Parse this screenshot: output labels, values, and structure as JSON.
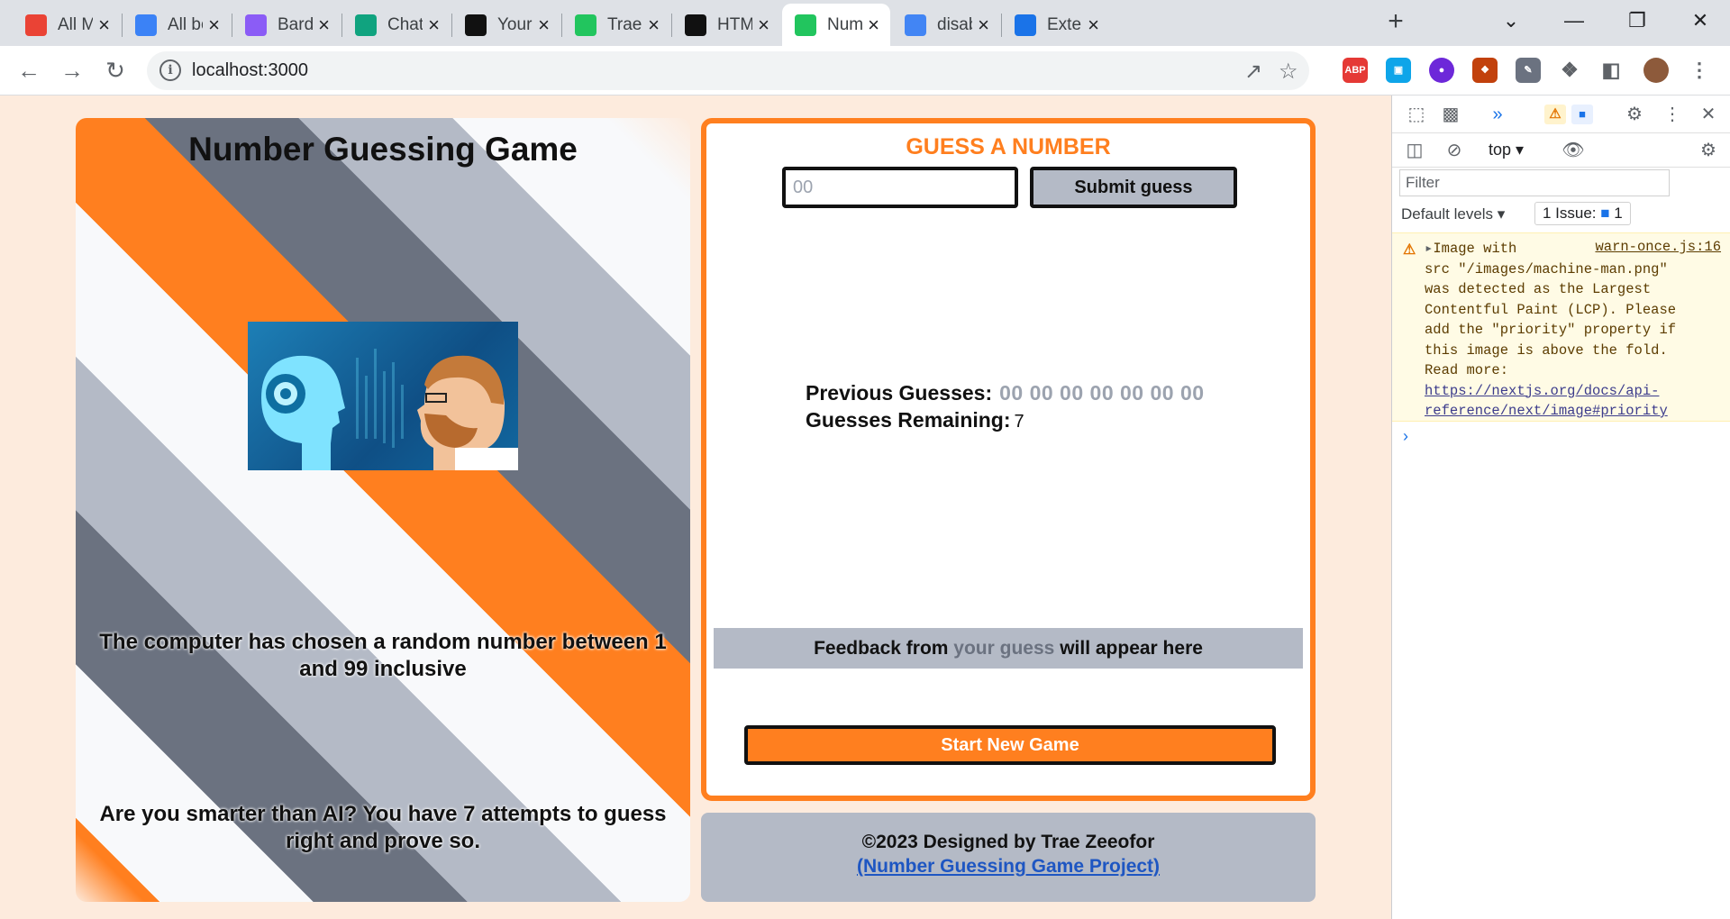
{
  "browser": {
    "tabs": [
      {
        "label": "All Mai",
        "icon": "gmail-icon",
        "color": "#ea4335"
      },
      {
        "label": "All boo",
        "icon": "cloud-icon",
        "color": "#3b82f6"
      },
      {
        "label": "Bard",
        "icon": "bard-icon",
        "color": "#8b5cf6"
      },
      {
        "label": "ChatGI",
        "icon": "chatgpt-icon",
        "color": "#10a37f"
      },
      {
        "label": "Your lis",
        "icon": "github-icon",
        "color": "#111111"
      },
      {
        "label": "Trae's",
        "icon": "pixel-icon",
        "color": "#22c55e"
      },
      {
        "label": "HTML",
        "icon": "notion-icon",
        "color": "#111111"
      },
      {
        "label": "Numbe",
        "icon": "pixel-icon",
        "color": "#22c55e"
      },
      {
        "label": "disable",
        "icon": "google-icon",
        "color": "#4285f4"
      },
      {
        "label": "Extensi",
        "icon": "puzzle-icon",
        "color": "#1a73e8"
      }
    ],
    "address": "localhost:3000"
  },
  "page": {
    "left": {
      "title": "Number Guessing Game",
      "description": "The computer has chosen a random number between 1 and 99 inclusive",
      "challenge": "Are you smarter than AI? You have 7 attempts to guess right and prove so."
    },
    "right": {
      "heading": "GUESS A NUMBER",
      "input_placeholder": "00",
      "submit_label": "Submit guess",
      "previous_label": "Previous Guesses:",
      "previous_values": "00 00 00 00 00 00 00",
      "remaining_label": "Guesses Remaining:",
      "remaining_value": "7",
      "feedback_pre": "Feedback from",
      "feedback_mid": "your guess",
      "feedback_post": "will appear here",
      "new_game_label": "Start New Game"
    },
    "footer": {
      "copyright": "©2023 Designed by Trae Zeeofor",
      "project_link": "(Number Guessing Game Project)"
    }
  },
  "devtools": {
    "context": "top",
    "filter_placeholder": "Filter",
    "levels": "Default levels",
    "issues": "1 Issue:",
    "issues_count": "1",
    "warning_source": "warn-once.js:16",
    "warning_text": "Image with\nsrc \"/images/machine-man.png\"\nwas detected as the Largest\nContentful Paint (LCP). Please\nadd the \"priority\" property if\nthis image is above the fold.\nRead more: ",
    "warning_link": "https://nextjs.org/docs/api-reference/next/image#priority"
  }
}
